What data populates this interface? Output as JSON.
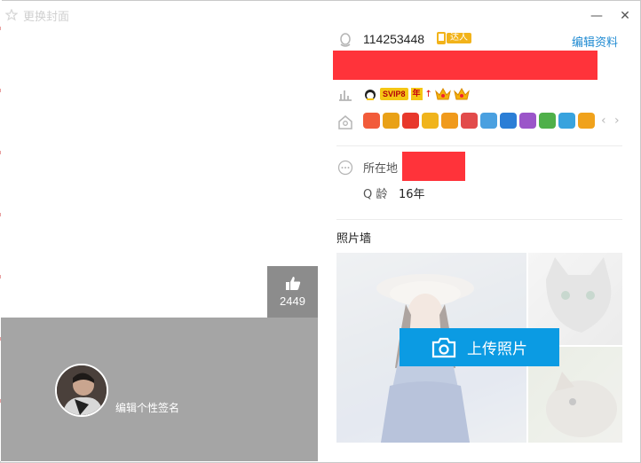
{
  "window": {
    "title": "更换封面",
    "minimize_glyph": "—",
    "close_glyph": "✕"
  },
  "cover": {
    "like_count": "2449",
    "signature": "编辑个性签名"
  },
  "profile": {
    "qq_number": "114253448",
    "daren_tag": "达人",
    "edit_link": "编辑资料",
    "vip_label": "SVIP8",
    "nian_label": "年",
    "location_label": "所在地",
    "age_label": "Q 龄",
    "age_value": "16年"
  },
  "photo_wall": {
    "title": "照片墙",
    "upload_label": "上传照片"
  },
  "icons": [
    "qq-penguin-icon",
    "chart-icon",
    "badge-house-icon",
    "more-icon",
    "camera-icon",
    "thumb-up-icon"
  ],
  "colors": {
    "accent": "#0b9be3",
    "link": "#1f8ad2",
    "redact": "#ff333a",
    "cover_gray": "#a5a5a5",
    "like_box": "#8c8c8c"
  },
  "badges": [
    {
      "name": "badge-1",
      "color": "#f25b3a"
    },
    {
      "name": "badge-2",
      "color": "#e9a117"
    },
    {
      "name": "badge-3",
      "color": "#e8382c"
    },
    {
      "name": "badge-4",
      "color": "#f0b41c"
    },
    {
      "name": "badge-5",
      "color": "#f09a1c"
    },
    {
      "name": "badge-6",
      "color": "#e24b4b"
    },
    {
      "name": "badge-7",
      "color": "#4aa0e0"
    },
    {
      "name": "badge-8",
      "color": "#2b7ed6"
    },
    {
      "name": "badge-9",
      "color": "#9b55c9"
    },
    {
      "name": "badge-10",
      "color": "#4fb04a"
    },
    {
      "name": "badge-11",
      "color": "#38a3de"
    },
    {
      "name": "badge-12",
      "color": "#f0a21c"
    }
  ]
}
